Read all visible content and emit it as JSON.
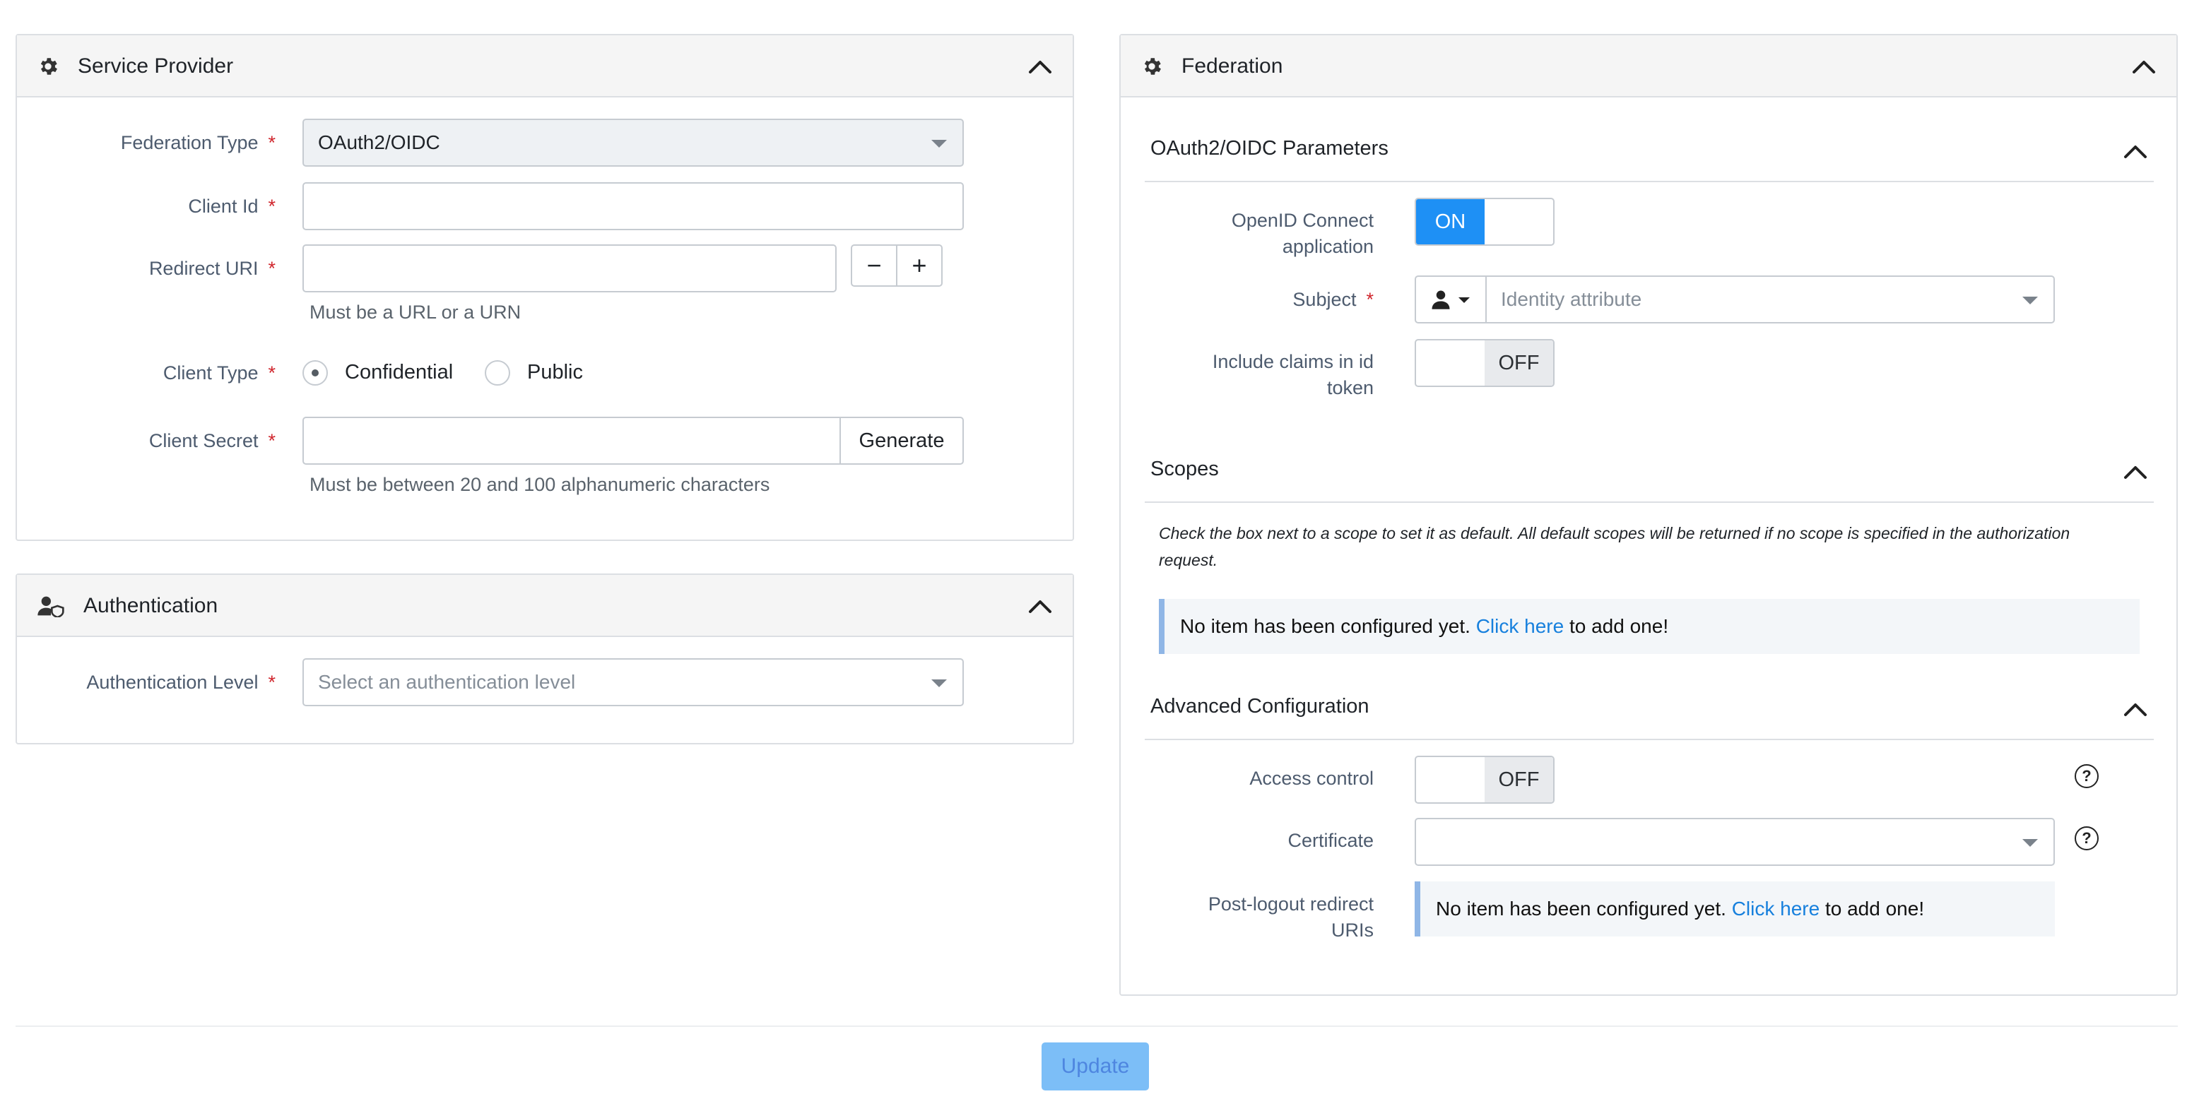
{
  "service_provider": {
    "title": "Service Provider",
    "federation_type": {
      "label": "Federation Type",
      "value": "OAuth2/OIDC"
    },
    "client_id": {
      "label": "Client Id",
      "value": ""
    },
    "redirect_uri": {
      "label": "Redirect URI",
      "value": "",
      "help": "Must be a URL or a URN",
      "minus": "−",
      "plus": "+"
    },
    "client_type": {
      "label": "Client Type",
      "options": [
        "Confidential",
        "Public"
      ],
      "selected": "Confidential"
    },
    "client_secret": {
      "label": "Client Secret",
      "value": "",
      "button": "Generate",
      "help": "Must be between 20 and 100 alphanumeric characters"
    }
  },
  "authentication": {
    "title": "Authentication",
    "level": {
      "label": "Authentication Level",
      "placeholder": "Select an authentication level"
    }
  },
  "federation": {
    "title": "Federation",
    "oidc_params": {
      "title": "OAuth2/OIDC Parameters",
      "openid_connect": {
        "label_line1": "OpenID Connect",
        "label_line2": "application",
        "state": "ON"
      },
      "subject": {
        "label": "Subject",
        "placeholder": "Identity attribute"
      },
      "include_claims": {
        "label_line1": "Include claims in id",
        "label_line2": "token",
        "state": "OFF"
      }
    },
    "scopes": {
      "title": "Scopes",
      "note_line1": "Check the box next to a scope to set it as default. All default scopes will be returned if no scope is specified in the authorization",
      "note_line2": "request.",
      "empty_prefix": "No item has been configured yet.",
      "empty_link": "Click here",
      "empty_suffix": "to add one!"
    },
    "advanced": {
      "title": "Advanced Configuration",
      "access_control": {
        "label": "Access control",
        "state": "OFF"
      },
      "certificate": {
        "label": "Certificate",
        "value": ""
      },
      "post_logout": {
        "label_line1": "Post-logout redirect",
        "label_line2": "URIs",
        "empty_prefix": "No item has been configured yet.",
        "empty_link": "Click here",
        "empty_suffix": "to add one!"
      }
    }
  },
  "footer": {
    "update_label": "Update"
  },
  "colors": {
    "accent": "#1e90f5",
    "required": "#d0262d",
    "link": "#1780dd",
    "update_button": "#7cbef7"
  },
  "icons": [
    "gear-icon",
    "chevron-up-icon",
    "user-shield-icon",
    "user-icon",
    "caret-down-icon",
    "help-icon"
  ]
}
